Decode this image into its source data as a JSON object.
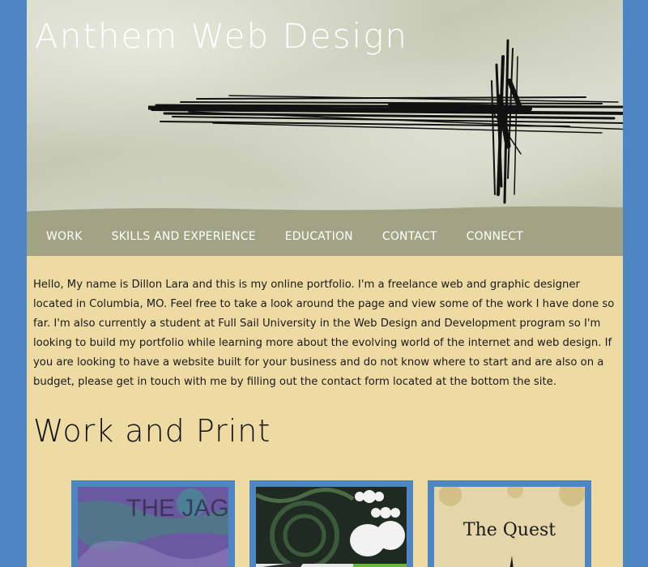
{
  "header": {
    "site_title": "Anthem Web Design"
  },
  "nav": {
    "items": [
      "WORK",
      "SKILLS AND EXPERIENCE",
      "EDUCATION",
      "CONTACT",
      "CONNECT"
    ]
  },
  "intro": {
    "text": "Hello, My name is Dillon Lara and this is my online portfolio. I'm a freelance web and graphic designer located in Columbia, MO. Feel free to take a look around the page and view some of the work I have done so far. I'm also currently a student at Full Sail University in the Web Design and Development program so I'm looking to build my portfolio while learning more about the evolving world of the internet and web design. If you are looking to have a website built for your business and do not know where to start and are also on a budget, please get in touch with me by filling out the contact form located at the bottom the site."
  },
  "work": {
    "title": "Work and Print",
    "items": [
      {
        "caption": "THE JAGUAR SHARK"
      },
      {
        "caption": ""
      },
      {
        "caption": "The Quest"
      }
    ]
  },
  "colors": {
    "background": "#4d86c3",
    "content": "#eedba3",
    "nav": "#a1a484"
  }
}
